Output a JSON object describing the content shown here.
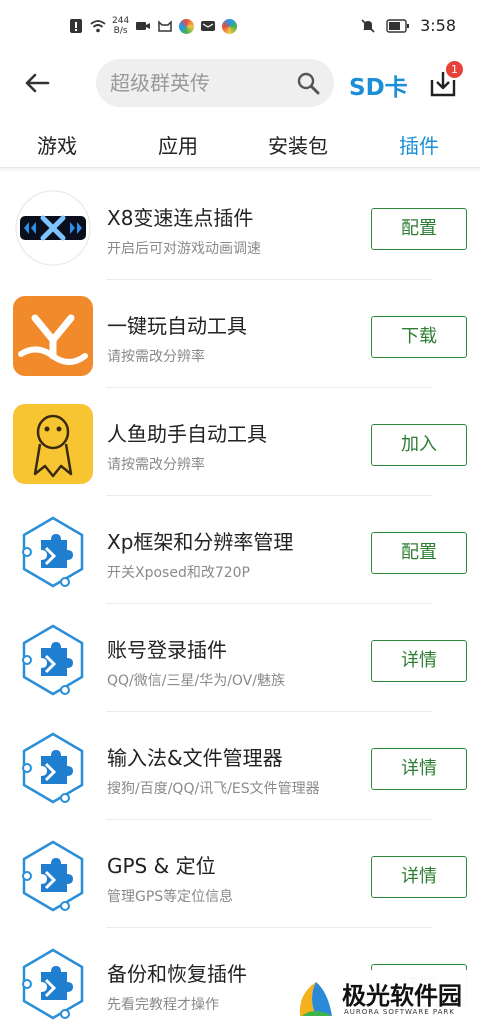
{
  "status_bar": {
    "speed_value": "244",
    "speed_unit": "B/s",
    "time": "3:58"
  },
  "top_bar": {
    "search_placeholder": "超级群英传",
    "sd_card_label": "SD卡",
    "download_badge": "1"
  },
  "tabs": [
    {
      "label": "游戏",
      "active": false
    },
    {
      "label": "应用",
      "active": false
    },
    {
      "label": "安装包",
      "active": false
    },
    {
      "label": "插件",
      "active": true
    }
  ],
  "plugins": [
    {
      "title": "X8变速连点插件",
      "subtitle": "开启后可对游戏动画调速",
      "button": "配置",
      "icon": "x8-speed-icon"
    },
    {
      "title": "一键玩自动工具",
      "subtitle": "请按需改分辨率",
      "button": "下载",
      "icon": "y-logo-icon"
    },
    {
      "title": "人鱼助手自动工具",
      "subtitle": "请按需改分辨率",
      "button": "加入",
      "icon": "mermaid-icon"
    },
    {
      "title": "Xp框架和分辨率管理",
      "subtitle": "开关Xposed和改720P",
      "button": "配置",
      "icon": "puzzle-hex-icon"
    },
    {
      "title": "账号登录插件",
      "subtitle": "QQ/微信/三星/华为/OV/魅族",
      "button": "详情",
      "icon": "puzzle-hex-icon"
    },
    {
      "title": "输入法&文件管理器",
      "subtitle": "搜狗/百度/QQ/讯飞/ES文件管理器",
      "button": "详情",
      "icon": "puzzle-hex-icon"
    },
    {
      "title": "GPS & 定位",
      "subtitle": "管理GPS等定位信息",
      "button": "详情",
      "icon": "puzzle-hex-icon"
    },
    {
      "title": "备份和恢复插件",
      "subtitle": "先看完教程才操作",
      "button": "详情",
      "icon": "puzzle-hex-icon"
    }
  ],
  "watermark": {
    "text": "极光软件园",
    "subtext": "AURORA SOFTWARE PARK"
  },
  "colors": {
    "accent_blue": "#1a8fd8",
    "button_green": "#2e8b3c",
    "badge_red": "#e8413a"
  }
}
